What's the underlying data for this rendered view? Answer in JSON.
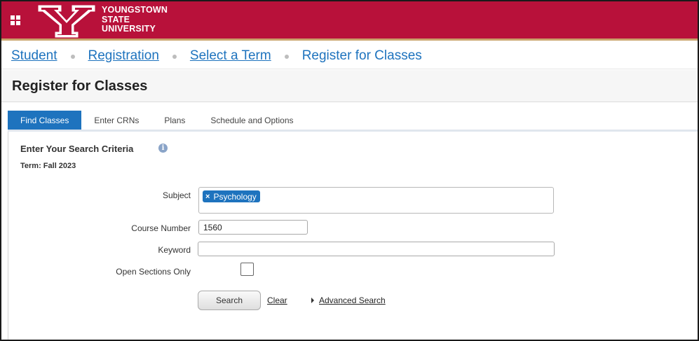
{
  "header": {
    "logo_lines": [
      "YOUNGSTOWN",
      "STATE",
      "UNIVERSITY"
    ],
    "brand_color": "#b8113a",
    "accent_color": "#c9a46b"
  },
  "breadcrumb": {
    "items": [
      "Student",
      "Registration",
      "Select a Term"
    ],
    "current": "Register for Classes"
  },
  "page": {
    "title": "Register for Classes"
  },
  "tabs": [
    {
      "label": "Find Classes",
      "active": true
    },
    {
      "label": "Enter CRNs",
      "active": false
    },
    {
      "label": "Plans",
      "active": false
    },
    {
      "label": "Schedule and Options",
      "active": false
    }
  ],
  "search": {
    "heading": "Enter Your Search Criteria",
    "info_icon": "i",
    "term": "Term: Fall 2023",
    "subject_label": "Subject",
    "subject_chip": "Psychology",
    "subject_chip_remove": "×",
    "course_number_label": "Course Number",
    "course_number_value": "1560",
    "keyword_label": "Keyword",
    "keyword_value": "",
    "open_sections_label": "Open Sections Only",
    "open_sections_checked": false,
    "search_button": "Search",
    "clear_link": "Clear",
    "advanced_link": "Advanced Search"
  }
}
